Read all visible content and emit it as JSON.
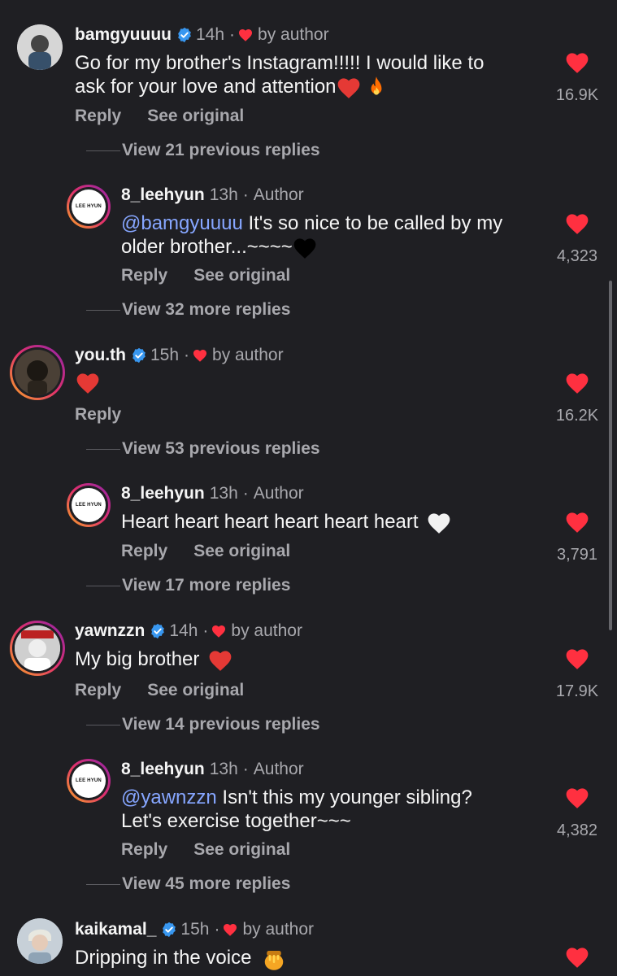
{
  "comments": [
    {
      "username": "bamgyuuuu",
      "time": "14h",
      "by_author": "by author",
      "text_lines": [
        "Go for my brother's Instagram!!!!! I would like to",
        "ask for your love and attention"
      ],
      "emojis": [
        "heart-emoji",
        "fire-emoji"
      ],
      "reply": "Reply",
      "see_original": "See original",
      "likes": "16.9K",
      "view_replies": "View 21 previous replies",
      "author_reply": {
        "username": "8_leehyun",
        "time": "13h",
        "author_label": "Author",
        "avatar_text": "LEE HYUN",
        "mention": "@bamgyuuuu",
        "text_lines": [
          " It's so nice to be called by my",
          "older brother...~~~~"
        ],
        "emoji": "black-heart-emoji",
        "reply": "Reply",
        "see_original": "See original",
        "likes": "4,323",
        "view_more": "View 32 more replies"
      }
    },
    {
      "username": "you.th",
      "time": "15h",
      "by_author": "by author",
      "emoji": "heart-emoji",
      "reply": "Reply",
      "likes": "16.2K",
      "view_replies": "View 53 previous replies",
      "author_reply": {
        "username": "8_leehyun",
        "time": "13h",
        "author_label": "Author",
        "avatar_text": "LEE HYUN",
        "text": "Heart heart heart heart heart heart",
        "emoji": "white-heart-emoji",
        "reply": "Reply",
        "see_original": "See original",
        "likes": "3,791",
        "view_more": "View 17 more replies"
      }
    },
    {
      "username": "yawnzzn",
      "time": "14h",
      "by_author": "by author",
      "text": "My big brother",
      "emoji": "heart-emoji",
      "reply": "Reply",
      "see_original": "See original",
      "likes": "17.9K",
      "view_replies": "View 14 previous replies",
      "author_reply": {
        "username": "8_leehyun",
        "time": "13h",
        "author_label": "Author",
        "avatar_text": "LEE HYUN",
        "mention": "@yawnzzn",
        "text_lines": [
          " Isn't this my younger sibling?",
          "Let's exercise together~~~"
        ],
        "reply": "Reply",
        "see_original": "See original",
        "likes": "4,382",
        "view_more": "View 45 more replies"
      }
    },
    {
      "username": "kaikamal_",
      "time": "15h",
      "by_author": "by author",
      "text": "Dripping in the voice",
      "emoji": "honey-pot-emoji"
    }
  ],
  "separator": "·",
  "colors": {
    "background": "#1f1f23",
    "like_red": "#ff3040",
    "verified_blue": "#3897f0",
    "mention_blue": "#86a6ff",
    "muted_text": "#a8a8ad"
  }
}
